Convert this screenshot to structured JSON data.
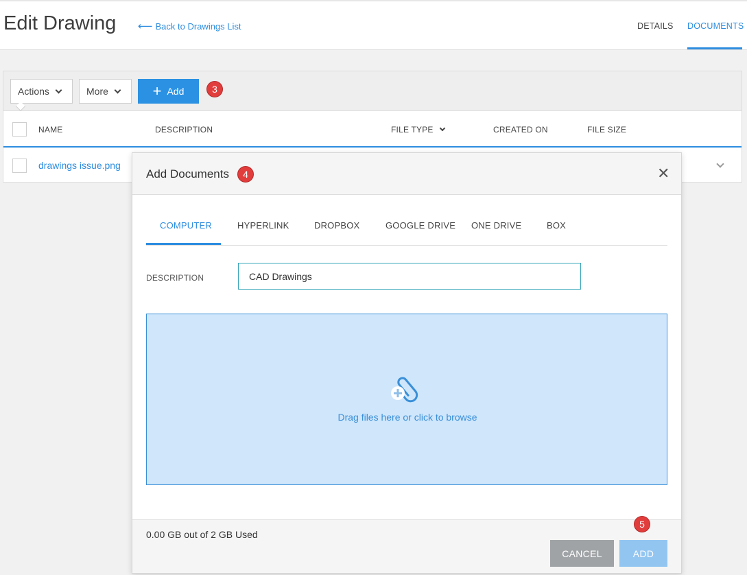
{
  "header": {
    "title": "Edit Drawing",
    "back_link": "Back to Drawings List",
    "tabs": [
      {
        "label": "DETAILS",
        "active": false
      },
      {
        "label": "DOCUMENTS",
        "active": true
      }
    ]
  },
  "toolbar": {
    "actions_label": "Actions",
    "more_label": "More",
    "add_label": "Add",
    "step_badge": "3"
  },
  "table": {
    "columns": [
      "NAME",
      "DESCRIPTION",
      "FILE TYPE",
      "CREATED ON",
      "FILE SIZE"
    ],
    "rows": [
      {
        "name": "drawings issue.png"
      }
    ]
  },
  "modal": {
    "title": "Add Documents",
    "step_badge": "4",
    "tabs": [
      "COMPUTER",
      "HYPERLINK",
      "DROPBOX",
      "GOOGLE DRIVE",
      "ONE DRIVE",
      "BOX"
    ],
    "active_tab": "COMPUTER",
    "description_label": "DESCRIPTION",
    "description_value": "CAD Drawings",
    "dropzone_text": "Drag files here or click to browse",
    "storage_text": "0.00 GB out of 2 GB Used",
    "cancel_label": "CANCEL",
    "add_label": "ADD",
    "add_step_badge": "5"
  },
  "colors": {
    "accent": "#2d8de0",
    "badge": "#e23d3d",
    "dropzone_bg": "#cfe6fb"
  },
  "icons": {
    "back": "arrow-left-icon",
    "dropzone": "paperclip-plus-icon",
    "close": "close-icon"
  }
}
